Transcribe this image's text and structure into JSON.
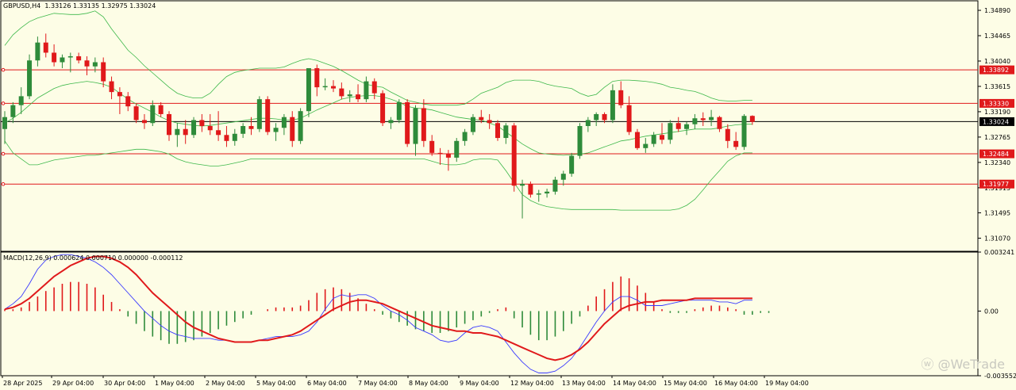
{
  "window": {
    "symbol_line": "GBPUSD,H4  1.33126 1.33135 1.32975 1.33024",
    "macd_line": "MACD(12,26,9) 0.000624 0.000710 0.000000 -0.000112"
  },
  "watermark": {
    "text": "@WeTrade",
    "icon": "wetrade-logo-icon"
  },
  "colors": {
    "background": "#fdfde6",
    "bull": "#2e8b3a",
    "bear": "#e0191b",
    "bands": "#3db84a",
    "level": "#e0191b",
    "macd_signal": "#e0191b",
    "macd_main": "#3a3aff",
    "current": "#000000"
  },
  "chart_data": [
    {
      "type": "candlestick",
      "symbol": "GBPUSD",
      "timeframe": "H4",
      "ylim": [
        1.3085,
        1.3505
      ],
      "y_ticks": [
        "1.34890",
        "1.34465",
        "1.34040",
        "1.33615",
        "1.33190",
        "1.32765",
        "1.32340",
        "1.31915",
        "1.31495",
        "1.31070"
      ],
      "x_labels": [
        "28 Apr 2025",
        "29 Apr 04:00",
        "30 Apr 04:00",
        "1 May 04:00",
        "2 May 04:00",
        "5 May 04:00",
        "6 May 04:00",
        "7 May 04:00",
        "8 May 04:00",
        "9 May 04:00",
        "12 May 04:00",
        "13 May 04:00",
        "14 May 04:00",
        "15 May 04:00",
        "16 May 04:00",
        "19 May 04:00"
      ],
      "horizontal_levels": [
        {
          "value": 1.33892,
          "label": "1.33892"
        },
        {
          "value": 1.3333,
          "label": "1.33330"
        },
        {
          "value": 1.32484,
          "label": "1.32484"
        },
        {
          "value": 1.31977,
          "label": "1.31977"
        }
      ],
      "current_price": {
        "value": 1.33024,
        "label": "1.33024"
      },
      "ohlc": [
        [
          1.329,
          1.332,
          1.3265,
          1.331
        ],
        [
          1.331,
          1.3335,
          1.33,
          1.333
        ],
        [
          1.333,
          1.336,
          1.3315,
          1.3345
        ],
        [
          1.3345,
          1.3415,
          1.334,
          1.3405
        ],
        [
          1.3405,
          1.3445,
          1.3395,
          1.3435
        ],
        [
          1.3435,
          1.345,
          1.341,
          1.3418
        ],
        [
          1.3418,
          1.3432,
          1.3395,
          1.3402
        ],
        [
          1.3402,
          1.3415,
          1.3392,
          1.341
        ],
        [
          1.341,
          1.3418,
          1.3385,
          1.3412
        ],
        [
          1.3412,
          1.3418,
          1.34,
          1.3405
        ],
        [
          1.3405,
          1.3412,
          1.338,
          1.3395
        ],
        [
          1.3395,
          1.341,
          1.3385,
          1.3402
        ],
        [
          1.3402,
          1.341,
          1.336,
          1.337
        ],
        [
          1.337,
          1.3378,
          1.334,
          1.3352
        ],
        [
          1.3352,
          1.336,
          1.3315,
          1.3345
        ],
        [
          1.3345,
          1.3352,
          1.332,
          1.3328
        ],
        [
          1.3328,
          1.3332,
          1.33,
          1.3305
        ],
        [
          1.3305,
          1.3315,
          1.329,
          1.33
        ],
        [
          1.33,
          1.3338,
          1.3295,
          1.333
        ],
        [
          1.333,
          1.3335,
          1.331,
          1.3315
        ],
        [
          1.3315,
          1.332,
          1.327,
          1.328
        ],
        [
          1.328,
          1.33,
          1.326,
          1.329
        ],
        [
          1.329,
          1.3305,
          1.3265,
          1.328
        ],
        [
          1.328,
          1.331,
          1.3275,
          1.3305
        ],
        [
          1.3305,
          1.3315,
          1.3285,
          1.3295
        ],
        [
          1.3295,
          1.3315,
          1.328,
          1.3288
        ],
        [
          1.3288,
          1.332,
          1.327,
          1.328
        ],
        [
          1.328,
          1.3295,
          1.326,
          1.327
        ],
        [
          1.327,
          1.329,
          1.3262,
          1.3282
        ],
        [
          1.3282,
          1.33,
          1.3275,
          1.3295
        ],
        [
          1.3295,
          1.331,
          1.328,
          1.329
        ],
        [
          1.329,
          1.3345,
          1.3285,
          1.334
        ],
        [
          1.334,
          1.3345,
          1.328,
          1.3285
        ],
        [
          1.3285,
          1.33,
          1.327,
          1.3292
        ],
        [
          1.3292,
          1.3315,
          1.328,
          1.331
        ],
        [
          1.331,
          1.332,
          1.326,
          1.327
        ],
        [
          1.327,
          1.3325,
          1.3265,
          1.332
        ],
        [
          1.332,
          1.339,
          1.331,
          1.3392
        ],
        [
          1.3392,
          1.3398,
          1.3345,
          1.336
        ],
        [
          1.336,
          1.3375,
          1.3355,
          1.3362
        ],
        [
          1.3362,
          1.3372,
          1.3352,
          1.3358
        ],
        [
          1.3358,
          1.3368,
          1.334,
          1.3345
        ],
        [
          1.3345,
          1.3355,
          1.3335,
          1.3348
        ],
        [
          1.3348,
          1.3365,
          1.3335,
          1.334
        ],
        [
          1.334,
          1.3378,
          1.3335,
          1.337
        ],
        [
          1.337,
          1.3375,
          1.334,
          1.335
        ],
        [
          1.335,
          1.3355,
          1.3295,
          1.33
        ],
        [
          1.33,
          1.331,
          1.329,
          1.3305
        ],
        [
          1.3305,
          1.334,
          1.33,
          1.3335
        ],
        [
          1.3335,
          1.334,
          1.326,
          1.3265
        ],
        [
          1.3265,
          1.333,
          1.3245,
          1.3325
        ],
        [
          1.3325,
          1.334,
          1.326,
          1.327
        ],
        [
          1.327,
          1.328,
          1.3245,
          1.325
        ],
        [
          1.325,
          1.3258,
          1.323,
          1.3248
        ],
        [
          1.3248,
          1.3255,
          1.322,
          1.3242
        ],
        [
          1.3242,
          1.3275,
          1.3235,
          1.327
        ],
        [
          1.327,
          1.329,
          1.3262,
          1.3285
        ],
        [
          1.3285,
          1.3315,
          1.328,
          1.331
        ],
        [
          1.331,
          1.3322,
          1.33,
          1.3305
        ],
        [
          1.3305,
          1.3315,
          1.329,
          1.33
        ],
        [
          1.33,
          1.3305,
          1.327,
          1.3275
        ],
        [
          1.3275,
          1.33,
          1.3265,
          1.3296
        ],
        [
          1.3296,
          1.33,
          1.3185,
          1.3195
        ],
        [
          1.3195,
          1.3205,
          1.314,
          1.3198
        ],
        [
          1.3198,
          1.3202,
          1.3175,
          1.318
        ],
        [
          1.318,
          1.3188,
          1.3168,
          1.3182
        ],
        [
          1.3182,
          1.319,
          1.3175,
          1.3185
        ],
        [
          1.3185,
          1.321,
          1.318,
          1.3205
        ],
        [
          1.3205,
          1.322,
          1.3195,
          1.3215
        ],
        [
          1.3215,
          1.325,
          1.321,
          1.3245
        ],
        [
          1.3245,
          1.33,
          1.324,
          1.3295
        ],
        [
          1.3295,
          1.331,
          1.3285,
          1.3305
        ],
        [
          1.3305,
          1.3318,
          1.3295,
          1.3315
        ],
        [
          1.3315,
          1.3318,
          1.33,
          1.3305
        ],
        [
          1.3305,
          1.3365,
          1.33,
          1.3355
        ],
        [
          1.3355,
          1.337,
          1.3325,
          1.333
        ],
        [
          1.333,
          1.3345,
          1.328,
          1.3285
        ],
        [
          1.3285,
          1.329,
          1.3255,
          1.3258
        ],
        [
          1.3258,
          1.3275,
          1.325,
          1.3265
        ],
        [
          1.3265,
          1.3285,
          1.326,
          1.328
        ],
        [
          1.328,
          1.33,
          1.3265,
          1.3272
        ],
        [
          1.3272,
          1.3305,
          1.3265,
          1.33
        ],
        [
          1.33,
          1.331,
          1.3285,
          1.329
        ],
        [
          1.329,
          1.3302,
          1.328,
          1.3298
        ],
        [
          1.3298,
          1.3315,
          1.329,
          1.3308
        ],
        [
          1.3308,
          1.3318,
          1.3295,
          1.3305
        ],
        [
          1.3305,
          1.3322,
          1.3295,
          1.331
        ],
        [
          1.331,
          1.3312,
          1.3285,
          1.329
        ],
        [
          1.329,
          1.3298,
          1.3258,
          1.327
        ],
        [
          1.327,
          1.3285,
          1.3255,
          1.326
        ],
        [
          1.326,
          1.3315,
          1.3255,
          1.3312
        ],
        [
          1.3312,
          1.3313,
          1.3297,
          1.3302
        ]
      ],
      "bollinger_upper": [
        1.343,
        1.3448,
        1.346,
        1.347,
        1.3476,
        1.348,
        1.3484,
        1.3483,
        1.3482,
        1.3482,
        1.3484,
        1.3488,
        1.3478,
        1.3458,
        1.344,
        1.3422,
        1.341,
        1.3396,
        1.3384,
        1.3372,
        1.336,
        1.335,
        1.3345,
        1.3342,
        1.3342,
        1.335,
        1.3365,
        1.3378,
        1.3385,
        1.3388,
        1.339,
        1.3392,
        1.3392,
        1.3392,
        1.3394,
        1.34,
        1.3405,
        1.3408,
        1.3405,
        1.34,
        1.3395,
        1.3388,
        1.338,
        1.3372,
        1.3365,
        1.3362,
        1.336,
        1.3352,
        1.3345,
        1.3338,
        1.3335,
        1.3332,
        1.333,
        1.333,
        1.333,
        1.333,
        1.3332,
        1.334,
        1.335,
        1.3355,
        1.336,
        1.3368,
        1.3372,
        1.3372,
        1.3372,
        1.337,
        1.3365,
        1.3362,
        1.336,
        1.3358,
        1.335,
        1.3345,
        1.3348,
        1.336,
        1.337,
        1.3372,
        1.3372,
        1.3371,
        1.337,
        1.3368,
        1.3365,
        1.336,
        1.3358,
        1.3355,
        1.3353,
        1.3348,
        1.3342,
        1.3338,
        1.3337,
        1.3337,
        1.3338,
        1.3338
      ],
      "bollinger_middle": [
        1.33,
        1.3308,
        1.3318,
        1.333,
        1.3342,
        1.335,
        1.3358,
        1.3363,
        1.3366,
        1.3368,
        1.337,
        1.3368,
        1.3365,
        1.336,
        1.335,
        1.334,
        1.3332,
        1.3325,
        1.3318,
        1.331,
        1.3304,
        1.33,
        1.3298,
        1.3296,
        1.3295,
        1.3296,
        1.3298,
        1.33,
        1.3302,
        1.3304,
        1.3306,
        1.3308,
        1.3308,
        1.3307,
        1.3305,
        1.3305,
        1.3308,
        1.3315,
        1.3322,
        1.3328,
        1.3334,
        1.334,
        1.3343,
        1.3345,
        1.3346,
        1.3346,
        1.3344,
        1.334,
        1.3335,
        1.3328,
        1.3325,
        1.3324,
        1.3322,
        1.3318,
        1.3314,
        1.331,
        1.3308,
        1.3306,
        1.3305,
        1.33,
        1.3295,
        1.3285,
        1.3275,
        1.3265,
        1.3257,
        1.325,
        1.3248,
        1.3247,
        1.3246,
        1.3247,
        1.3248,
        1.325,
        1.3255,
        1.326,
        1.3265,
        1.327,
        1.3272,
        1.3275,
        1.3278,
        1.328,
        1.3282,
        1.3284,
        1.3286,
        1.3288,
        1.329,
        1.329,
        1.329,
        1.3292,
        1.3295,
        1.3297,
        1.3298,
        1.3298
      ],
      "bollinger_lower": [
        1.327,
        1.325,
        1.324,
        1.323,
        1.323,
        1.3234,
        1.3238,
        1.324,
        1.3242,
        1.3244,
        1.3246,
        1.3246,
        1.3248,
        1.325,
        1.3252,
        1.3254,
        1.3256,
        1.3256,
        1.3254,
        1.3252,
        1.3248,
        1.324,
        1.3235,
        1.3232,
        1.323,
        1.3228,
        1.3228,
        1.323,
        1.3233,
        1.3236,
        1.324,
        1.324,
        1.324,
        1.324,
        1.324,
        1.324,
        1.324,
        1.324,
        1.324,
        1.324,
        1.324,
        1.324,
        1.324,
        1.324,
        1.324,
        1.324,
        1.324,
        1.324,
        1.324,
        1.324,
        1.324,
        1.324,
        1.3236,
        1.3232,
        1.323,
        1.323,
        1.3232,
        1.3238,
        1.324,
        1.324,
        1.3238,
        1.322,
        1.32,
        1.318,
        1.317,
        1.3164,
        1.316,
        1.3158,
        1.3156,
        1.3155,
        1.3155,
        1.3155,
        1.3155,
        1.3155,
        1.3155,
        1.3154,
        1.3154,
        1.3154,
        1.3154,
        1.3154,
        1.3154,
        1.3154,
        1.3156,
        1.3162,
        1.3172,
        1.3188,
        1.3205,
        1.322,
        1.3236,
        1.3245,
        1.325,
        1.325
      ]
    },
    {
      "type": "macd",
      "params": "MACD(12,26,9)",
      "ylim": [
        -0.003552,
        0.003241
      ],
      "y_ticks": [
        "0.003241",
        "0.00",
        "-0.003552"
      ],
      "histogram": [
        0.0001,
        0.0001,
        0.0002,
        0.0005,
        0.0008,
        0.0011,
        0.0013,
        0.0015,
        0.0016,
        0.0016,
        0.0015,
        0.0013,
        0.0009,
        0.0005,
        0.0001,
        -0.0003,
        -0.0007,
        -0.0011,
        -0.0014,
        -0.0016,
        -0.0018,
        -0.0018,
        -0.0017,
        -0.0016,
        -0.0014,
        -0.0012,
        -0.001,
        -0.0008,
        -0.0006,
        -0.0004,
        -0.0002,
        0.0,
        0.0001,
        0.0002,
        0.0002,
        0.0002,
        0.0003,
        0.0006,
        0.001,
        0.0012,
        0.0013,
        0.0012,
        0.001,
        0.0007,
        0.0004,
        0.0001,
        -0.0002,
        -0.0004,
        -0.0006,
        -0.0008,
        -0.001,
        -0.0011,
        -0.0012,
        -0.0012,
        -0.0011,
        -0.0009,
        -0.0007,
        -0.0005,
        -0.0003,
        -0.0001,
        0.0001,
        0.0002,
        -0.0004,
        -0.0009,
        -0.0013,
        -0.0016,
        -0.0016,
        -0.0014,
        -0.0011,
        -0.0007,
        -0.0003,
        0.0003,
        0.0008,
        0.0012,
        0.0016,
        0.0019,
        0.0018,
        0.0014,
        0.001,
        0.0005,
        0.0001,
        -0.0001,
        -0.0001,
        -0.0001,
        0.0001,
        0.0002,
        0.0003,
        0.0003,
        0.0002,
        0.0001,
        -0.0002,
        -0.0002,
        -0.0001,
        -0.0001
      ],
      "macd_main": [
        0.0001,
        0.0004,
        0.0008,
        0.0015,
        0.0023,
        0.0028,
        0.003,
        0.0031,
        0.0031,
        0.003,
        0.0029,
        0.0027,
        0.0024,
        0.002,
        0.0015,
        0.001,
        0.0005,
        0.0,
        -0.0004,
        -0.0008,
        -0.0011,
        -0.0013,
        -0.0014,
        -0.0015,
        -0.0015,
        -0.0015,
        -0.0016,
        -0.0016,
        -0.0017,
        -0.0017,
        -0.0017,
        -0.0016,
        -0.0015,
        -0.0014,
        -0.0014,
        -0.0014,
        -0.0013,
        -0.0011,
        -0.0006,
        0.0001,
        0.0007,
        0.0009,
        0.0008,
        0.0009,
        0.0009,
        0.0007,
        0.0003,
        0.0,
        -0.0002,
        -0.0005,
        -0.0009,
        -0.0011,
        -0.0013,
        -0.0016,
        -0.0017,
        -0.0016,
        -0.0012,
        -0.0009,
        -0.0008,
        -0.0009,
        -0.0011,
        -0.0017,
        -0.0023,
        -0.0028,
        -0.0032,
        -0.0034,
        -0.0034,
        -0.0033,
        -0.003,
        -0.0026,
        -0.002,
        -0.0013,
        -0.0006,
        0.0,
        0.0005,
        0.0008,
        0.0008,
        0.0006,
        0.0003,
        0.0003,
        0.0003,
        0.0004,
        0.0005,
        0.0006,
        0.0006,
        0.0006,
        0.0006,
        0.0005,
        0.0005,
        0.0004,
        0.0006,
        0.0006
      ],
      "macd_signal": [
        0.0001,
        0.0002,
        0.0004,
        0.0007,
        0.0011,
        0.0015,
        0.0019,
        0.0022,
        0.0025,
        0.0027,
        0.0029,
        0.003,
        0.003,
        0.0029,
        0.0027,
        0.0024,
        0.002,
        0.0015,
        0.001,
        0.0006,
        0.0002,
        -0.0002,
        -0.0006,
        -0.0009,
        -0.0011,
        -0.0013,
        -0.0015,
        -0.0016,
        -0.0017,
        -0.0017,
        -0.0017,
        -0.0016,
        -0.0016,
        -0.0015,
        -0.0014,
        -0.0013,
        -0.0011,
        -0.0008,
        -0.0005,
        -0.0002,
        0.0001,
        0.0003,
        0.0005,
        0.0006,
        0.0006,
        0.0005,
        0.0004,
        0.0002,
        0.0,
        -0.0002,
        -0.0004,
        -0.0006,
        -0.0008,
        -0.0009,
        -0.001,
        -0.0011,
        -0.0011,
        -0.0012,
        -0.0012,
        -0.0013,
        -0.0014,
        -0.0016,
        -0.0018,
        -0.002,
        -0.0022,
        -0.0024,
        -0.0026,
        -0.0027,
        -0.0026,
        -0.0024,
        -0.0021,
        -0.0017,
        -0.0012,
        -0.0007,
        -0.0003,
        0.0001,
        0.0003,
        0.0004,
        0.0005,
        0.0005,
        0.0006,
        0.0006,
        0.0006,
        0.0006,
        0.0007,
        0.0007,
        0.0007,
        0.0007,
        0.0007,
        0.0007,
        0.0007,
        0.0007
      ]
    }
  ]
}
